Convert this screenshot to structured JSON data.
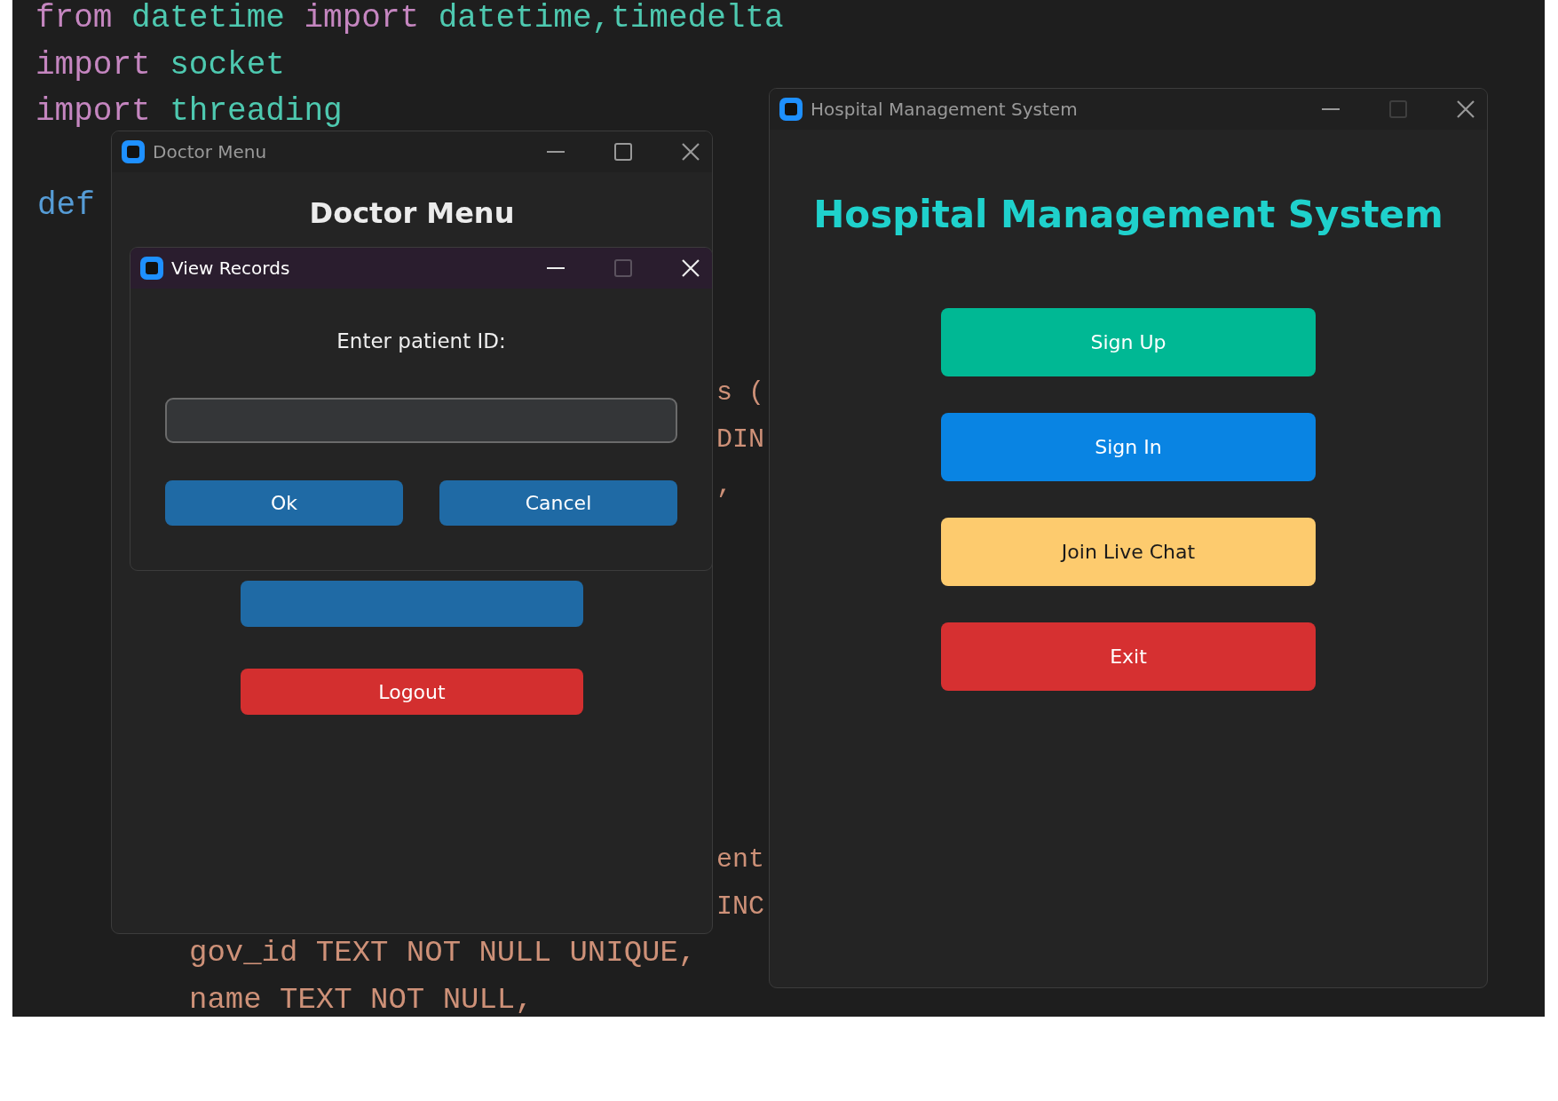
{
  "editor_lines": [
    {
      "tokens": [
        {
          "kind": "keyword",
          "text": "from "
        },
        {
          "kind": "module",
          "text": "datetime "
        },
        {
          "kind": "keyword",
          "text": "import "
        },
        {
          "kind": "module",
          "text": "datetime,timedelta"
        }
      ]
    },
    {
      "tokens": [
        {
          "kind": "keyword",
          "text": "import "
        },
        {
          "kind": "module",
          "text": "socket"
        }
      ]
    },
    {
      "tokens": [
        {
          "kind": "keyword",
          "text": "import "
        },
        {
          "kind": "module",
          "text": "threading"
        }
      ]
    },
    {
      "tokens": [
        {
          "kind": "def",
          "text": "def"
        }
      ]
    },
    {
      "tokens": [
        {
          "kind": "string",
          "text": "s ("
        }
      ]
    },
    {
      "tokens": [
        {
          "kind": "string",
          "text": "DIN"
        }
      ]
    },
    {
      "tokens": [
        {
          "kind": "string",
          "text": ","
        }
      ]
    },
    {
      "tokens": [
        {
          "kind": "string",
          "text": "ent"
        }
      ]
    },
    {
      "tokens": [
        {
          "kind": "string",
          "text": "INC"
        }
      ]
    },
    {
      "tokens": [
        {
          "kind": "string",
          "text": "gov_id TEXT NOT NULL UNIQUE,"
        }
      ]
    },
    {
      "tokens": [
        {
          "kind": "string",
          "text": "name TEXT NOT NULL,"
        }
      ]
    }
  ],
  "doctor_menu_window": {
    "title": "Doctor Menu",
    "active": false,
    "maximize_enabled": true,
    "heading": "Doctor Menu",
    "buttons": [
      {
        "color": "#1f6aa5"
      },
      {
        "label": "Logout",
        "color": "#d32f2f"
      }
    ]
  },
  "view_records_dialog": {
    "title": "View Records",
    "active": true,
    "maximize_enabled": false,
    "prompt": "Enter patient ID:",
    "buttons": [
      {
        "label": "Ok",
        "color": "#1f6aa5"
      },
      {
        "label": "Cancel",
        "color": "#1f6aa5"
      }
    ]
  },
  "main_window": {
    "title": "Hospital Management System",
    "active": false,
    "maximize_enabled": false,
    "heading": "Hospital Management System",
    "buttons": [
      {
        "label": "Sign Up",
        "color": "#00b894"
      },
      {
        "label": "Sign In",
        "color": "#0984e3"
      },
      {
        "label": "Join Live Chat",
        "color": "#fdcb6e"
      },
      {
        "label": "Exit",
        "color": "#d63031"
      }
    ]
  }
}
